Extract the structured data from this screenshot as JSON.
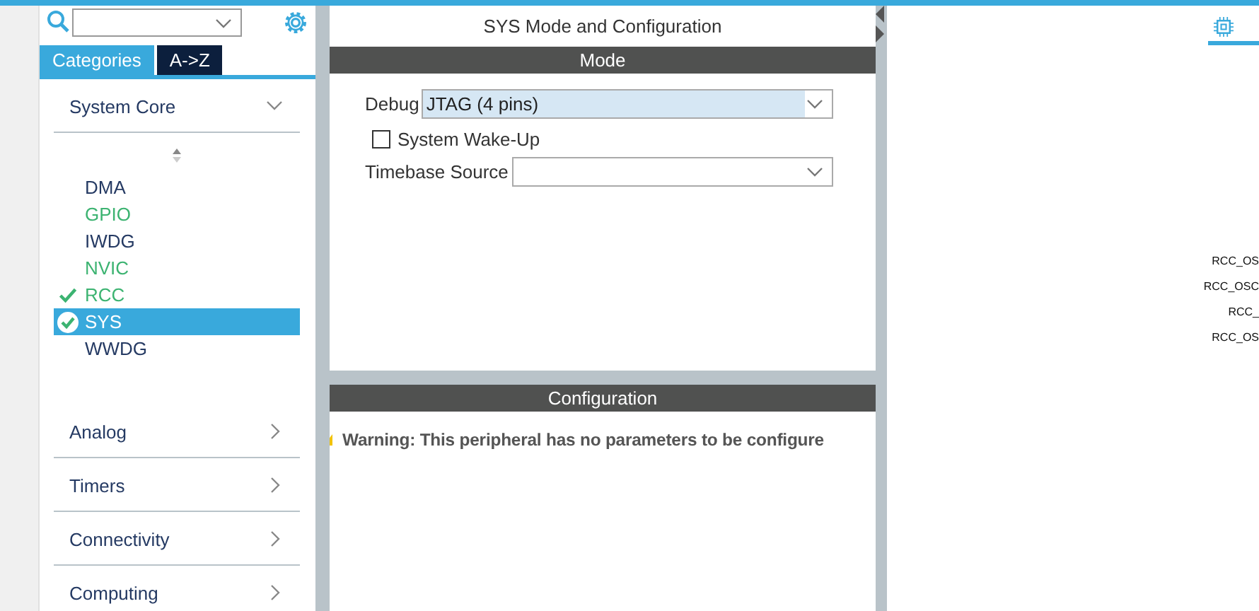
{
  "sidebar": {
    "tabs": [
      {
        "label": "Categories",
        "selected": true
      },
      {
        "label": "A->Z",
        "selected": false
      }
    ],
    "categories": [
      {
        "label": "System Core",
        "expanded": true,
        "items": [
          {
            "label": "DMA",
            "configured": false,
            "checked": false,
            "selected": false
          },
          {
            "label": "GPIO",
            "configured": true,
            "checked": false,
            "selected": false
          },
          {
            "label": "IWDG",
            "configured": false,
            "checked": false,
            "selected": false
          },
          {
            "label": "NVIC",
            "configured": true,
            "checked": false,
            "selected": false
          },
          {
            "label": "RCC",
            "configured": true,
            "checked": true,
            "selected": false
          },
          {
            "label": "SYS",
            "configured": true,
            "checked": true,
            "selected": true
          },
          {
            "label": "WWDG",
            "configured": false,
            "checked": false,
            "selected": false
          }
        ]
      },
      {
        "label": "Analog",
        "expanded": false
      },
      {
        "label": "Timers",
        "expanded": false
      },
      {
        "label": "Connectivity",
        "expanded": false
      },
      {
        "label": "Computing",
        "expanded": false
      }
    ]
  },
  "panel": {
    "title": "SYS Mode and Configuration",
    "mode": {
      "header": "Mode",
      "debug_label": "Debug",
      "debug_value": "JTAG (4 pins)",
      "wakeup_label": "System Wake-Up",
      "wakeup_checked": false,
      "timebase_label": "Timebase Source"
    },
    "configuration": {
      "header": "Configuration",
      "warning": "Warning: This peripheral has no parameters to be configure"
    }
  },
  "pinout": {
    "pin_labels": [
      "RCC_OS",
      "RCC_OSC",
      "RCC_",
      "RCC_OS"
    ]
  }
}
